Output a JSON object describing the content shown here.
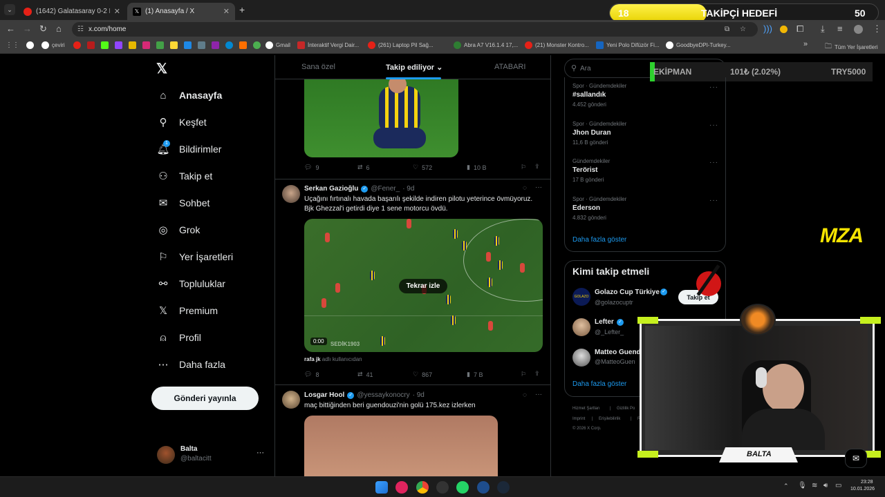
{
  "browser": {
    "tabs": [
      {
        "title": "(1642) Galatasaray 0-2 Fenerba"
      },
      {
        "title": "(1) Anasayfa / X"
      }
    ],
    "url": "x.com/home",
    "bookmarks": [
      "çeviri",
      "Gmail",
      "İnteraktif Vergi Dair...",
      "(261) Laptop Pil Sağ...",
      "Abra A7 V16.1.4 17,...",
      "(21) Monster Kontro...",
      "Yeni Polo Difüzör Fi...",
      "GoodbyeDPI-Turkey...",
      "Tüm Yer İşaretleri"
    ],
    "overflow": "»"
  },
  "overlay": {
    "goal_current": "18",
    "goal_label": "TAKİPÇİ HEDEFİ",
    "goal_target": "50",
    "goal_progress": 0.36,
    "ticker": [
      "EKİPMAN",
      "101₺ (2.02%)",
      "TRY5000"
    ],
    "logo": "MZA",
    "cam_name": "BALTA"
  },
  "nav": {
    "items": [
      {
        "label": "Anasayfa",
        "icon": "home-icon"
      },
      {
        "label": "Keşfet",
        "icon": "search-icon"
      },
      {
        "label": "Bildirimler",
        "icon": "bell-icon",
        "badge": "1"
      },
      {
        "label": "Takip et",
        "icon": "person-add-icon"
      },
      {
        "label": "Sohbet",
        "icon": "mail-icon"
      },
      {
        "label": "Grok",
        "icon": "grok-icon"
      },
      {
        "label": "Yer İşaretleri",
        "icon": "bookmark-icon"
      },
      {
        "label": "Topluluklar",
        "icon": "communities-icon"
      },
      {
        "label": "Premium",
        "icon": "x-icon"
      },
      {
        "label": "Profil",
        "icon": "profile-icon"
      },
      {
        "label": "Daha fazla",
        "icon": "more-icon"
      }
    ],
    "post_button": "Gönderi yayınla",
    "account_name": "Balta",
    "account_handle": "@baltacitt",
    "account_more": "···"
  },
  "feed": {
    "tabs": [
      "Sana özel",
      "Takip ediliyor",
      "ATABARI"
    ],
    "active_tab": "Takip ediliyor",
    "post0_actions": {
      "replies": "9",
      "reposts": "6",
      "likes": "572",
      "views": "10 B"
    },
    "post1": {
      "name": "Serkan Gazioğlu",
      "handle": "@Fener_",
      "time": "· 9d",
      "text1": "Uçağını fırtınalı havada başarılı şekilde indiren pilotu yeterince övmüyoruz.",
      "text2": "Bjk Ghezzal'i getirdi diye 1 sene motorcu övdü.",
      "replay": "Tekrar izle",
      "video_time": "0:00",
      "watermark": "SEDİK1903",
      "caption_user": "rafa jk",
      "caption_rest": " adlı kullanıcıdan",
      "actions": {
        "replies": "8",
        "reposts": "41",
        "likes": "867",
        "views": "7 B"
      }
    },
    "post2": {
      "name": "Losgar Hool",
      "handle": "@yessaykonocry",
      "time": "· 9d",
      "text": "maç bittiğinden beri guendouzi'nin golü 175.kez izlerken"
    }
  },
  "sidebar": {
    "search_placeholder": "Ara",
    "trends": [
      {
        "cat": "Spor · Gündemdekiler",
        "name": "#sallandık",
        "count": "4.452 gönderi"
      },
      {
        "cat": "Spor · Gündemdekiler",
        "name": "Jhon Duran",
        "count": "11,6 B gönderi"
      },
      {
        "cat": "Gündemdekiler",
        "name": "Terörist",
        "count": "17 B gönderi"
      },
      {
        "cat": "Spor · Gündemdekiler",
        "name": "Ederson",
        "count": "4.832 gönderi"
      }
    ],
    "trend_more": "···",
    "show_more": "Daha fazla göster",
    "wtf_title": "Kimi takip etmeli",
    "who": [
      {
        "name": "Golazo Cup Türkiye",
        "handle": "@golazocuptr"
      },
      {
        "name": "Lefter",
        "handle": "@_Lefter_"
      },
      {
        "name": "Matteo Guend",
        "handle": "@MatteoGuen"
      }
    ],
    "follow": "Takip et",
    "wtf_more": "Daha fazla göster",
    "footer": [
      "Hizmet Şartları",
      "|",
      "Gizlilik Po",
      "Imprint",
      "|",
      "Erişilebilirlik",
      "|",
      "Re",
      "© 2026 X Corp."
    ]
  },
  "taskbar": {
    "time": "23:28",
    "date": "10.01.2026"
  }
}
